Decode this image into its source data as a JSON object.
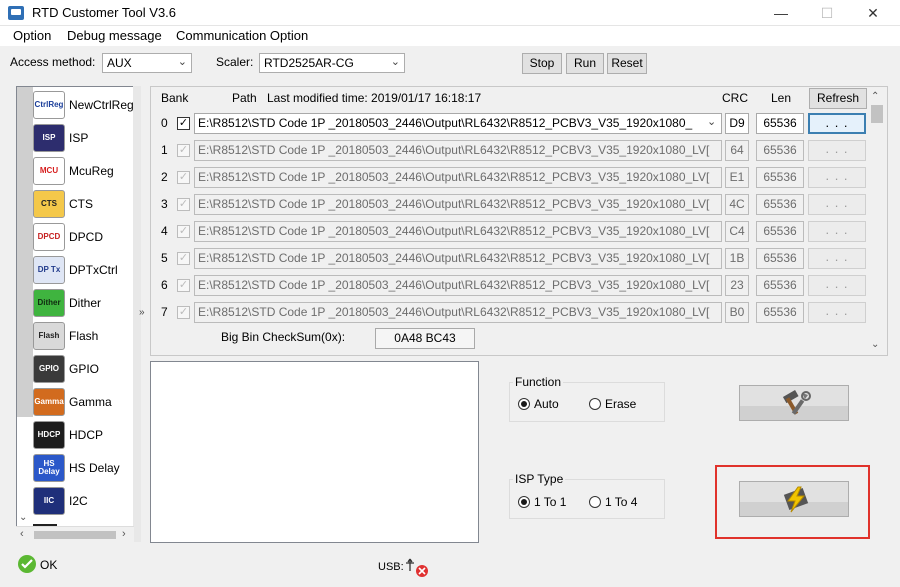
{
  "window": {
    "title": "RTD Customer Tool V3.6",
    "minimize": "—",
    "maximize": "☐",
    "close": "✕"
  },
  "menu": [
    "Option",
    "Debug message",
    "Communication Option"
  ],
  "toolbar": {
    "access_label": "Access method:",
    "access_value": "AUX",
    "scaler_label": "Scaler:",
    "scaler_value": "RTD2525AR-CG",
    "stop": "Stop",
    "run": "Run",
    "reset": "Reset"
  },
  "sidebar": {
    "items": [
      {
        "label": "NewCtrlReg",
        "icon": "ctrlreg-icon",
        "icon_text": "CtrlReg",
        "color": "#ffffff",
        "text_color": "#1c3f9a"
      },
      {
        "label": "ISP",
        "icon": "isp-chip-icon",
        "icon_text": "ISP",
        "color": "#2d2d6e",
        "text_color": "#ffffff"
      },
      {
        "label": "McuReg",
        "icon": "mcu-icon",
        "icon_text": "MCU",
        "color": "#ffffff",
        "text_color": "#d71f1f"
      },
      {
        "label": "CTS",
        "icon": "cts-icon",
        "icon_text": "CTS",
        "color": "#f4c84a",
        "text_color": "#222222"
      },
      {
        "label": "DPCD",
        "icon": "dpcd-icon",
        "icon_text": "DPCD",
        "color": "#ffffff",
        "text_color": "#c62020"
      },
      {
        "label": "DPTxCtrl",
        "icon": "dptx-icon",
        "icon_text": "DP Tx",
        "color": "#dfe6f5",
        "text_color": "#233c8c"
      },
      {
        "label": "Dither",
        "icon": "dither-icon",
        "icon_text": "Dither",
        "color": "#3fb43f",
        "text_color": "#102a10"
      },
      {
        "label": "Flash",
        "icon": "flash-icon",
        "icon_text": "Flash",
        "color": "#d9d9d9",
        "text_color": "#222222"
      },
      {
        "label": "GPIO",
        "icon": "gpio-icon",
        "icon_text": "GPIO",
        "color": "#3a3a3a",
        "text_color": "#ffffff"
      },
      {
        "label": "Gamma",
        "icon": "gamma-icon",
        "icon_text": "Gamma",
        "color": "#d26b1e",
        "text_color": "#ffffff"
      },
      {
        "label": "HDCP",
        "icon": "hdcp-icon",
        "icon_text": "HDCP",
        "color": "#1d1d1d",
        "text_color": "#ffffff"
      },
      {
        "label": "HS Delay",
        "icon": "hs-delay-icon",
        "icon_text": "HS Delay",
        "color": "#2b58c9",
        "text_color": "#ffffff"
      },
      {
        "label": "I2C",
        "icon": "i2c-icon",
        "icon_text": "IIC",
        "color": "#1f2f7a",
        "text_color": "#ffffff"
      }
    ]
  },
  "bank_panel": {
    "headers": {
      "bank": "Bank",
      "path": "Path",
      "last_modified": "Last modified time: 2019/01/17 16:18:17",
      "crc": "CRC",
      "len": "Len"
    },
    "refresh": "Refresh",
    "rows": [
      {
        "bank": "0",
        "checked": true,
        "enabled": true,
        "path": "E:\\R8512\\STD Code 1P _20180503_2446\\Output\\RL6432\\R8512_PCBV3_V35_1920x1080_",
        "crc": "D9",
        "len": "65536",
        "dots": ". . ."
      },
      {
        "bank": "1",
        "checked": true,
        "enabled": false,
        "path": "E:\\R8512\\STD Code 1P _20180503_2446\\Output\\RL6432\\R8512_PCBV3_V35_1920x1080_LV[",
        "crc": "64",
        "len": "65536",
        "dots": ". . ."
      },
      {
        "bank": "2",
        "checked": true,
        "enabled": false,
        "path": "E:\\R8512\\STD Code 1P _20180503_2446\\Output\\RL6432\\R8512_PCBV3_V35_1920x1080_LV[",
        "crc": "E1",
        "len": "65536",
        "dots": ". . ."
      },
      {
        "bank": "3",
        "checked": true,
        "enabled": false,
        "path": "E:\\R8512\\STD Code 1P _20180503_2446\\Output\\RL6432\\R8512_PCBV3_V35_1920x1080_LV[",
        "crc": "4C",
        "len": "65536",
        "dots": ". . ."
      },
      {
        "bank": "4",
        "checked": true,
        "enabled": false,
        "path": "E:\\R8512\\STD Code 1P _20180503_2446\\Output\\RL6432\\R8512_PCBV3_V35_1920x1080_LV[",
        "crc": "C4",
        "len": "65536",
        "dots": ". . ."
      },
      {
        "bank": "5",
        "checked": true,
        "enabled": false,
        "path": "E:\\R8512\\STD Code 1P _20180503_2446\\Output\\RL6432\\R8512_PCBV3_V35_1920x1080_LV[",
        "crc": "1B",
        "len": "65536",
        "dots": ". . ."
      },
      {
        "bank": "6",
        "checked": true,
        "enabled": false,
        "path": "E:\\R8512\\STD Code 1P _20180503_2446\\Output\\RL6432\\R8512_PCBV3_V35_1920x1080_LV[",
        "crc": "23",
        "len": "65536",
        "dots": ". . ."
      },
      {
        "bank": "7",
        "checked": true,
        "enabled": false,
        "path": "E:\\R8512\\STD Code 1P _20180503_2446\\Output\\RL6432\\R8512_PCBV3_V35_1920x1080_LV[",
        "crc": "B0",
        "len": "65536",
        "dots": ". . ."
      }
    ],
    "checksum_label": "Big Bin CheckSum(0x):",
    "checksum_value": "0A48 BC43"
  },
  "function_group": {
    "title": "Function",
    "options": [
      "Auto",
      "Erase"
    ],
    "selected": "Auto"
  },
  "isp_type_group": {
    "title": "ISP Type",
    "options": [
      "1 To 1",
      "1 To 4"
    ],
    "selected": "1 To 1"
  },
  "status": {
    "ok": "OK",
    "usb": "USB:"
  },
  "colors": {
    "highlight_box": "#e0322b",
    "button_focus": "#3c7fb1"
  }
}
